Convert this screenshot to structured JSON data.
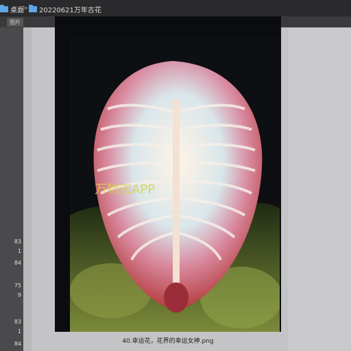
{
  "breadcrumb": {
    "items": [
      {
        "label": "桌面",
        "icon": "folder-icon"
      },
      {
        "label": "20220621万年古花",
        "icon": "folder-icon"
      }
    ],
    "separator": ">"
  },
  "tab": {
    "label": "图片"
  },
  "sidebar": {
    "values": [
      "83",
      "1",
      "84",
      "75",
      "9",
      "83",
      "1",
      "84"
    ]
  },
  "preview": {
    "watermark": "万物志APP",
    "filename": "40.幸运花，花界的幸运女神.png"
  },
  "colors": {
    "topbar": "#2b2b2d",
    "folder": "#5ea6e6",
    "watermark": "#d9d24a",
    "background": "#c4c4c6"
  }
}
